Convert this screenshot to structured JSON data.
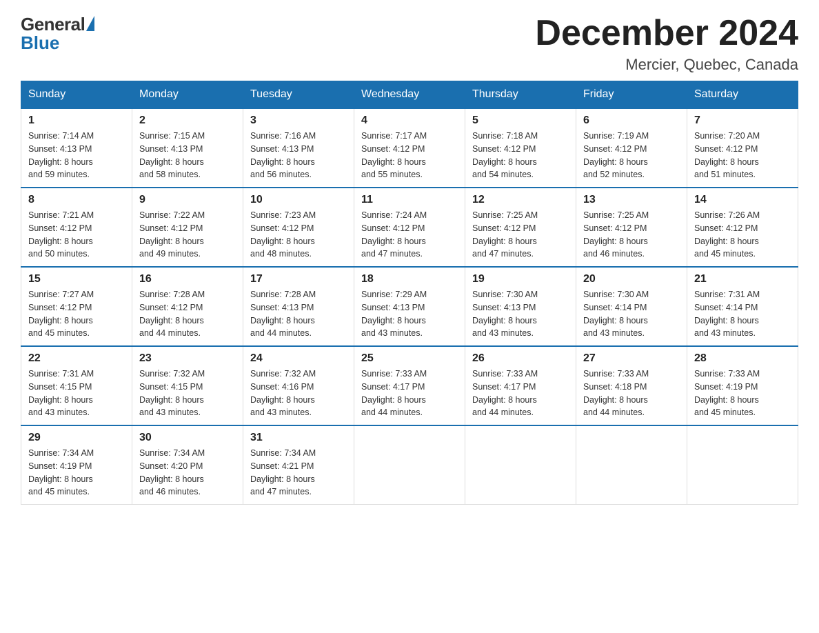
{
  "logo": {
    "general": "General",
    "blue": "Blue"
  },
  "title": "December 2024",
  "location": "Mercier, Quebec, Canada",
  "days_of_week": [
    "Sunday",
    "Monday",
    "Tuesday",
    "Wednesday",
    "Thursday",
    "Friday",
    "Saturday"
  ],
  "weeks": [
    [
      {
        "day": "1",
        "sunrise": "7:14 AM",
        "sunset": "4:13 PM",
        "daylight": "8 hours and 59 minutes."
      },
      {
        "day": "2",
        "sunrise": "7:15 AM",
        "sunset": "4:13 PM",
        "daylight": "8 hours and 58 minutes."
      },
      {
        "day": "3",
        "sunrise": "7:16 AM",
        "sunset": "4:13 PM",
        "daylight": "8 hours and 56 minutes."
      },
      {
        "day": "4",
        "sunrise": "7:17 AM",
        "sunset": "4:12 PM",
        "daylight": "8 hours and 55 minutes."
      },
      {
        "day": "5",
        "sunrise": "7:18 AM",
        "sunset": "4:12 PM",
        "daylight": "8 hours and 54 minutes."
      },
      {
        "day": "6",
        "sunrise": "7:19 AM",
        "sunset": "4:12 PM",
        "daylight": "8 hours and 52 minutes."
      },
      {
        "day": "7",
        "sunrise": "7:20 AM",
        "sunset": "4:12 PM",
        "daylight": "8 hours and 51 minutes."
      }
    ],
    [
      {
        "day": "8",
        "sunrise": "7:21 AM",
        "sunset": "4:12 PM",
        "daylight": "8 hours and 50 minutes."
      },
      {
        "day": "9",
        "sunrise": "7:22 AM",
        "sunset": "4:12 PM",
        "daylight": "8 hours and 49 minutes."
      },
      {
        "day": "10",
        "sunrise": "7:23 AM",
        "sunset": "4:12 PM",
        "daylight": "8 hours and 48 minutes."
      },
      {
        "day": "11",
        "sunrise": "7:24 AM",
        "sunset": "4:12 PM",
        "daylight": "8 hours and 47 minutes."
      },
      {
        "day": "12",
        "sunrise": "7:25 AM",
        "sunset": "4:12 PM",
        "daylight": "8 hours and 47 minutes."
      },
      {
        "day": "13",
        "sunrise": "7:25 AM",
        "sunset": "4:12 PM",
        "daylight": "8 hours and 46 minutes."
      },
      {
        "day": "14",
        "sunrise": "7:26 AM",
        "sunset": "4:12 PM",
        "daylight": "8 hours and 45 minutes."
      }
    ],
    [
      {
        "day": "15",
        "sunrise": "7:27 AM",
        "sunset": "4:12 PM",
        "daylight": "8 hours and 45 minutes."
      },
      {
        "day": "16",
        "sunrise": "7:28 AM",
        "sunset": "4:12 PM",
        "daylight": "8 hours and 44 minutes."
      },
      {
        "day": "17",
        "sunrise": "7:28 AM",
        "sunset": "4:13 PM",
        "daylight": "8 hours and 44 minutes."
      },
      {
        "day": "18",
        "sunrise": "7:29 AM",
        "sunset": "4:13 PM",
        "daylight": "8 hours and 43 minutes."
      },
      {
        "day": "19",
        "sunrise": "7:30 AM",
        "sunset": "4:13 PM",
        "daylight": "8 hours and 43 minutes."
      },
      {
        "day": "20",
        "sunrise": "7:30 AM",
        "sunset": "4:14 PM",
        "daylight": "8 hours and 43 minutes."
      },
      {
        "day": "21",
        "sunrise": "7:31 AM",
        "sunset": "4:14 PM",
        "daylight": "8 hours and 43 minutes."
      }
    ],
    [
      {
        "day": "22",
        "sunrise": "7:31 AM",
        "sunset": "4:15 PM",
        "daylight": "8 hours and 43 minutes."
      },
      {
        "day": "23",
        "sunrise": "7:32 AM",
        "sunset": "4:15 PM",
        "daylight": "8 hours and 43 minutes."
      },
      {
        "day": "24",
        "sunrise": "7:32 AM",
        "sunset": "4:16 PM",
        "daylight": "8 hours and 43 minutes."
      },
      {
        "day": "25",
        "sunrise": "7:33 AM",
        "sunset": "4:17 PM",
        "daylight": "8 hours and 44 minutes."
      },
      {
        "day": "26",
        "sunrise": "7:33 AM",
        "sunset": "4:17 PM",
        "daylight": "8 hours and 44 minutes."
      },
      {
        "day": "27",
        "sunrise": "7:33 AM",
        "sunset": "4:18 PM",
        "daylight": "8 hours and 44 minutes."
      },
      {
        "day": "28",
        "sunrise": "7:33 AM",
        "sunset": "4:19 PM",
        "daylight": "8 hours and 45 minutes."
      }
    ],
    [
      {
        "day": "29",
        "sunrise": "7:34 AM",
        "sunset": "4:19 PM",
        "daylight": "8 hours and 45 minutes."
      },
      {
        "day": "30",
        "sunrise": "7:34 AM",
        "sunset": "4:20 PM",
        "daylight": "8 hours and 46 minutes."
      },
      {
        "day": "31",
        "sunrise": "7:34 AM",
        "sunset": "4:21 PM",
        "daylight": "8 hours and 47 minutes."
      },
      null,
      null,
      null,
      null
    ]
  ],
  "labels": {
    "sunrise": "Sunrise:",
    "sunset": "Sunset:",
    "daylight": "Daylight:"
  }
}
